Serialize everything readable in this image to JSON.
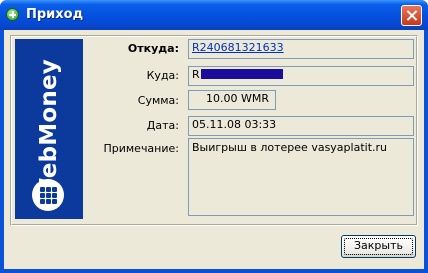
{
  "window": {
    "title": "Приход"
  },
  "form": {
    "from_label": "Откуда:",
    "from_value": "R240681321633",
    "to_label": "Куда:",
    "to_value": "R",
    "amount_label": "Сумма:",
    "amount_value": "10.00 WMR",
    "date_label": "Дата:",
    "date_value": "05.11.08 03:33",
    "note_label": "Примечание:",
    "note_value": "Выигрыш в лотерее vasyaplatit.ru"
  },
  "banner": {
    "brand_text": "WebMoney",
    "logo_icon": "webmoney-globe-icon"
  },
  "buttons": {
    "close_label": "Закрыть"
  },
  "colors": {
    "titlebar": "#0551e0",
    "banner": "#0c3a9c",
    "link": "#0030c0",
    "redaction": "#1a0d9c"
  }
}
